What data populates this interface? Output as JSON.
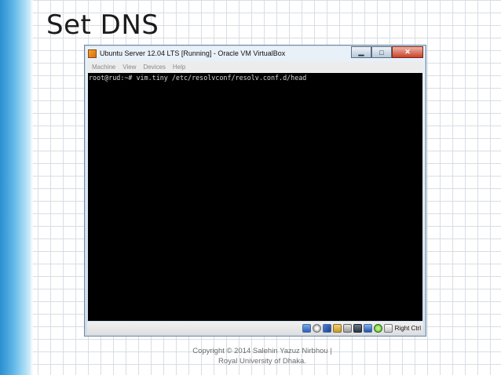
{
  "slide": {
    "title": "Set DNS",
    "copyright_line1": "Copyright © 2014 Salehin Yazuz Nirbhou |",
    "copyright_line2": "Royal University of Dhaka."
  },
  "window": {
    "title": "Ubuntu Server 12.04 LTS [Running] - Oracle VM VirtualBox",
    "minimize_glyph": "▁",
    "maximize_glyph": "□",
    "close_glyph": "✕"
  },
  "menu": {
    "items": [
      "Machine",
      "View",
      "Devices",
      "Help"
    ]
  },
  "console": {
    "line": "root@rud:~# vim.tiny /etc/resolvconf/resolv.conf.d/head"
  },
  "statusbar": {
    "icons": [
      "hard-disk-icon",
      "optical-drive-icon",
      "usb-icon",
      "shared-folder-icon",
      "network-icon",
      "display-icon",
      "virtualbox-icon",
      "mouse-capture-icon",
      "mouse-integration-icon"
    ],
    "host_key": "Right Ctrl"
  },
  "colors": {
    "accent_stripe": "#2a8fd0",
    "console_background": "#000000",
    "console_text": "#d8d8d8"
  }
}
